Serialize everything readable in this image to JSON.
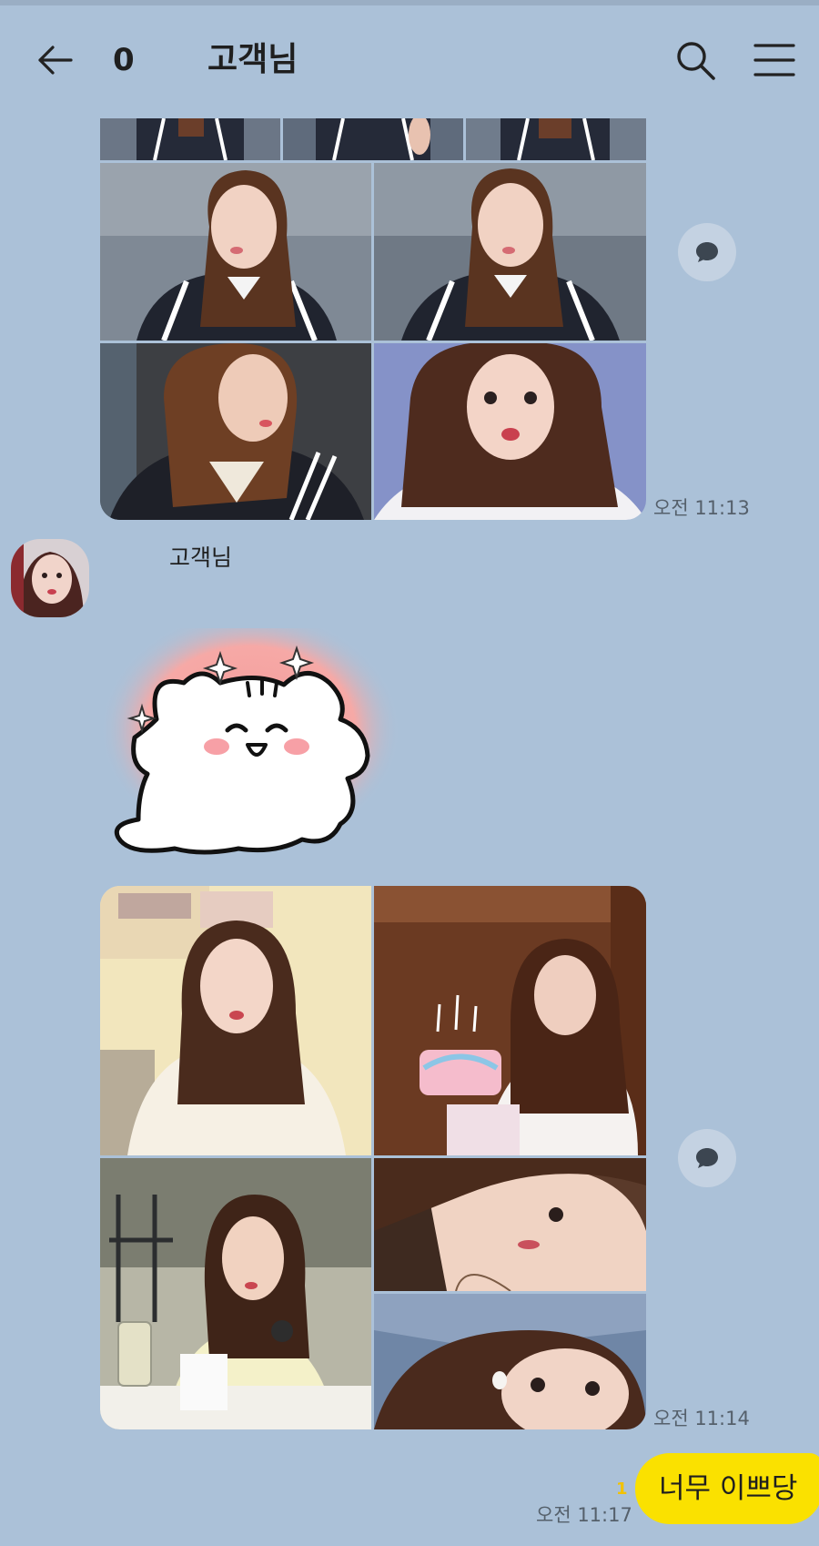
{
  "header": {
    "unread_count": "0",
    "title": "고객님",
    "icons": [
      "back-arrow-icon",
      "search-icon",
      "menu-icon"
    ]
  },
  "messages": [
    {
      "type": "photo-group",
      "time": "오전 11:13"
    },
    {
      "type": "sender",
      "name": "고객님"
    },
    {
      "type": "sticker",
      "description_icon": "sticker-bear-icon"
    },
    {
      "type": "photo-group",
      "time": "오전 11:14"
    },
    {
      "type": "my-message",
      "text": "너무 이쁘당",
      "unread": "1",
      "time": "오전 11:17"
    }
  ],
  "colors": {
    "background": "#abc1d8",
    "my_bubble": "#fae100",
    "unread": "#f2c200"
  }
}
